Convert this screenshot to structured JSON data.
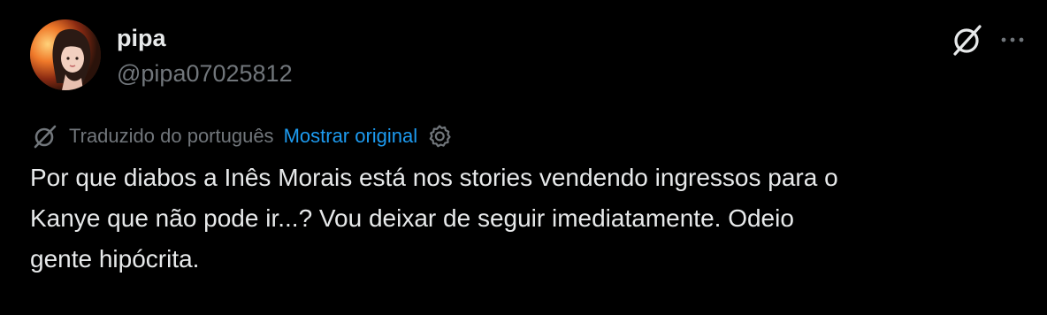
{
  "user": {
    "display_name": "pipa",
    "handle": "@pipa07025812"
  },
  "translation": {
    "label": "Traduzido do português",
    "show_original": "Mostrar original"
  },
  "tweet": {
    "lines": [
      "Por que diabos a Inês Morais está nos stories vendendo ingressos para o",
      "Kanye que não pode ir...? Vou deixar de seguir imediatamente. Odeio",
      "gente hipócrita."
    ]
  },
  "icons": {
    "grok": "grok-icon",
    "more": "more-icon",
    "translate": "translate-icon",
    "settings": "settings-icon"
  },
  "colors": {
    "background": "#000000",
    "text": "#e7e9ea",
    "muted": "#71767b",
    "link": "#1d9bf0"
  }
}
